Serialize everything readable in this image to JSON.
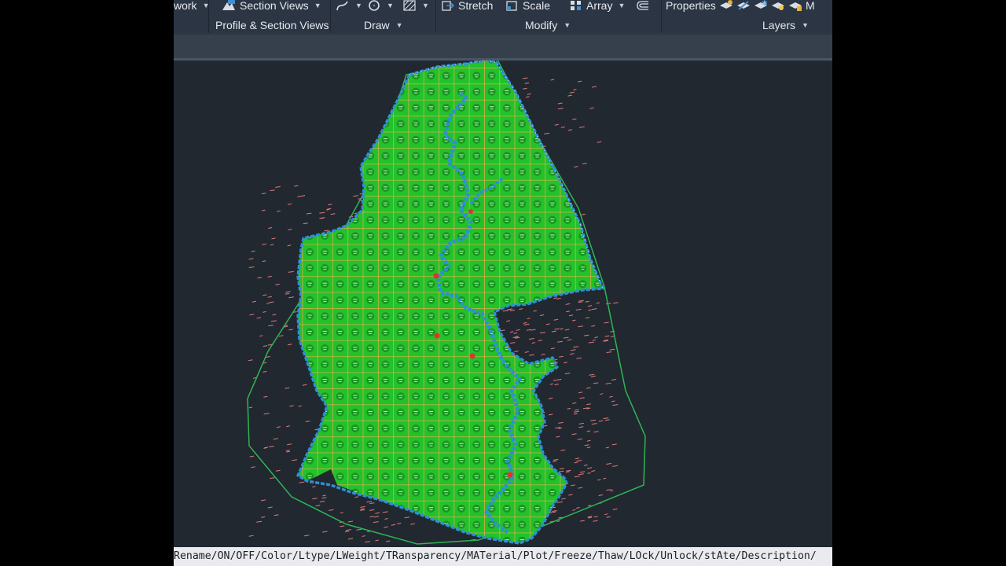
{
  "ribbon": {
    "row1": {
      "network": "work",
      "section_views": "Section Views",
      "stretch": "Stretch",
      "scale": "Scale",
      "array": "Array",
      "properties": "Properties",
      "match": "M"
    },
    "groups": {
      "profile_section_views": "Profile & Section Views",
      "draw": "Draw",
      "modify": "Modify",
      "layers": "Layers"
    }
  },
  "command_line": {
    "text": "Rename/ON/OFF/Color/Ltype/LWeight/TRansparency/MATerial/Plot/Freeze/Thaw/LOck/Unlock/stAte/Description/"
  },
  "colors": {
    "ribbon_bg": "#2b3544",
    "canvas_bg": "#212830",
    "hatch_fill": "#22c22a",
    "grid_lines": "#d6a94a",
    "boundary": "#2e8fd8",
    "hull": "#2fb553",
    "points": "#e07a7a"
  }
}
